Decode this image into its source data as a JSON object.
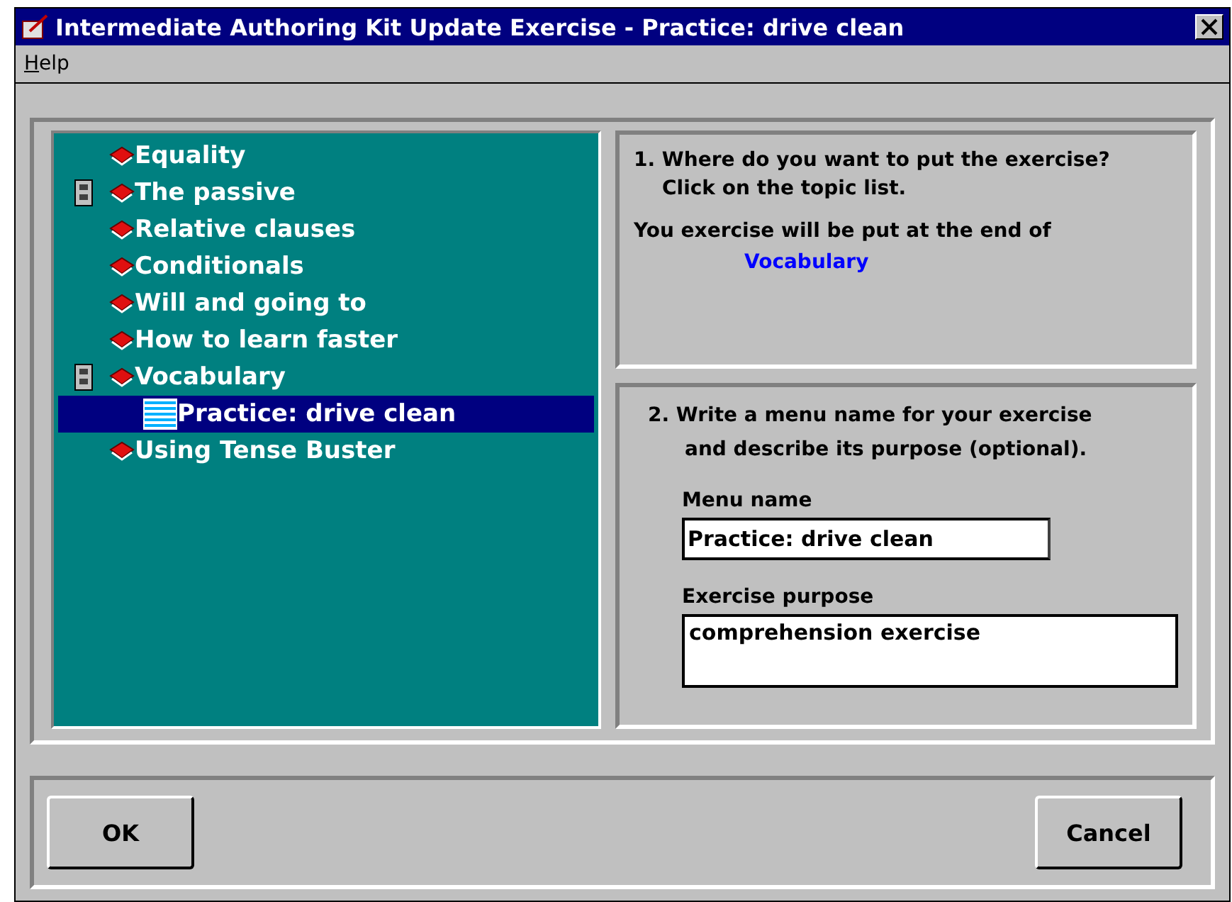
{
  "window": {
    "title": "Intermediate Authoring Kit Update Exercise - Practice: drive clean"
  },
  "menu": [
    {
      "label": "Help"
    }
  ],
  "topics": [
    {
      "label": "Equality",
      "kind": "book",
      "marker": false,
      "selected": false
    },
    {
      "label": "The passive",
      "kind": "book",
      "marker": true,
      "selected": false
    },
    {
      "label": "Relative clauses",
      "kind": "book",
      "marker": false,
      "selected": false
    },
    {
      "label": "Conditionals",
      "kind": "book",
      "marker": false,
      "selected": false
    },
    {
      "label": "Will and going to",
      "kind": "book",
      "marker": false,
      "selected": false
    },
    {
      "label": "How to learn faster",
      "kind": "book",
      "marker": false,
      "selected": false
    },
    {
      "label": "Vocabulary",
      "kind": "book",
      "marker": true,
      "selected": false,
      "children": [
        {
          "label": "Practice: drive clean",
          "kind": "page",
          "marker": false,
          "selected": true
        }
      ]
    },
    {
      "label": "Using Tense Buster",
      "kind": "book",
      "marker": false,
      "selected": false
    }
  ],
  "step1": {
    "heading": "1. Where do you want to put the exercise?",
    "subheading": "Click on the topic list.",
    "note": "You exercise will be put at the end of",
    "target": "Vocabulary"
  },
  "step2": {
    "heading": "2. Write a menu name for your exercise",
    "subheading": "and describe its purpose (optional).",
    "menu_name": {
      "label": "Menu name",
      "value": "Practice: drive clean"
    },
    "purpose": {
      "label": "Exercise purpose",
      "value": "comprehension exercise"
    }
  },
  "buttons": [
    {
      "label": "OK"
    },
    {
      "label": "Cancel"
    }
  ]
}
